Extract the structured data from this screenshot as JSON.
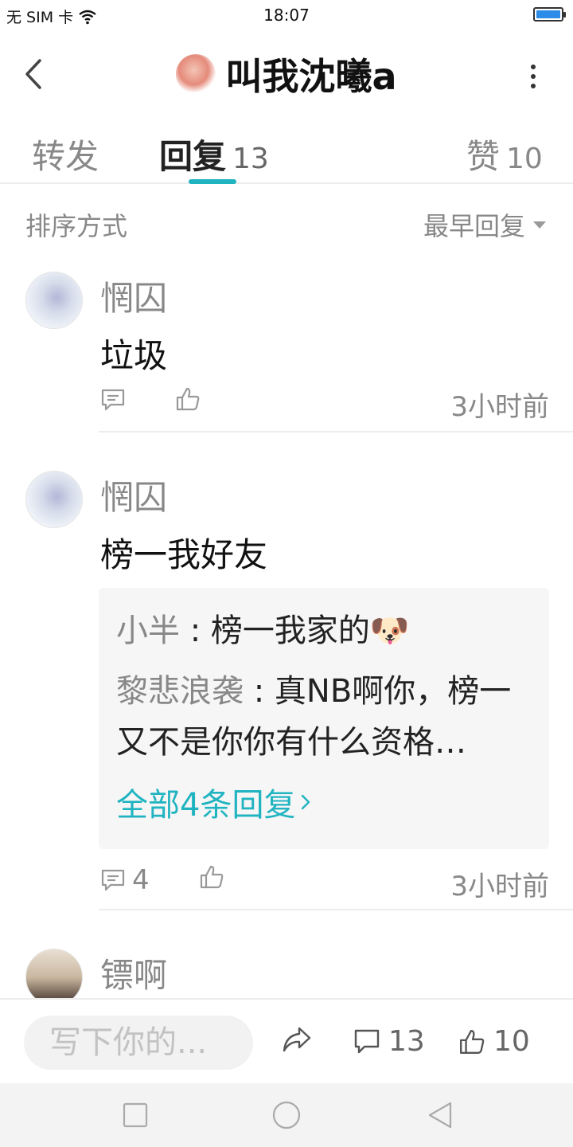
{
  "status_bar": {
    "carrier": "无 SIM 卡",
    "time": "18:07"
  },
  "header": {
    "title": "叫我沈曦a"
  },
  "tabs": [
    {
      "label": "转发",
      "count": ""
    },
    {
      "label": "回复",
      "count": "13"
    },
    {
      "label": "赞",
      "count": "10"
    }
  ],
  "sort": {
    "label": "排序方式",
    "value": "最早回复"
  },
  "comments": [
    {
      "author": "惘囚",
      "text": "垃圾",
      "reply_count": "",
      "time": "3小时前"
    },
    {
      "author": "惘囚",
      "text": "榜一我好友",
      "replies": [
        {
          "name": "小半",
          "text": "榜一我家的🐶"
        },
        {
          "name": "黎悲浪袭",
          "text": "真NB啊你，榜一又不是你你有什么资格…"
        }
      ],
      "view_all": "全部4条回复",
      "reply_count": "4",
      "time": "3小时前"
    },
    {
      "author": "镖啊"
    }
  ],
  "bottom_bar": {
    "input_placeholder": "写下你的...",
    "comment_count": "13",
    "like_count": "10"
  },
  "colors": {
    "accent": "#20b4c1",
    "battery": "#2d8ce8"
  }
}
